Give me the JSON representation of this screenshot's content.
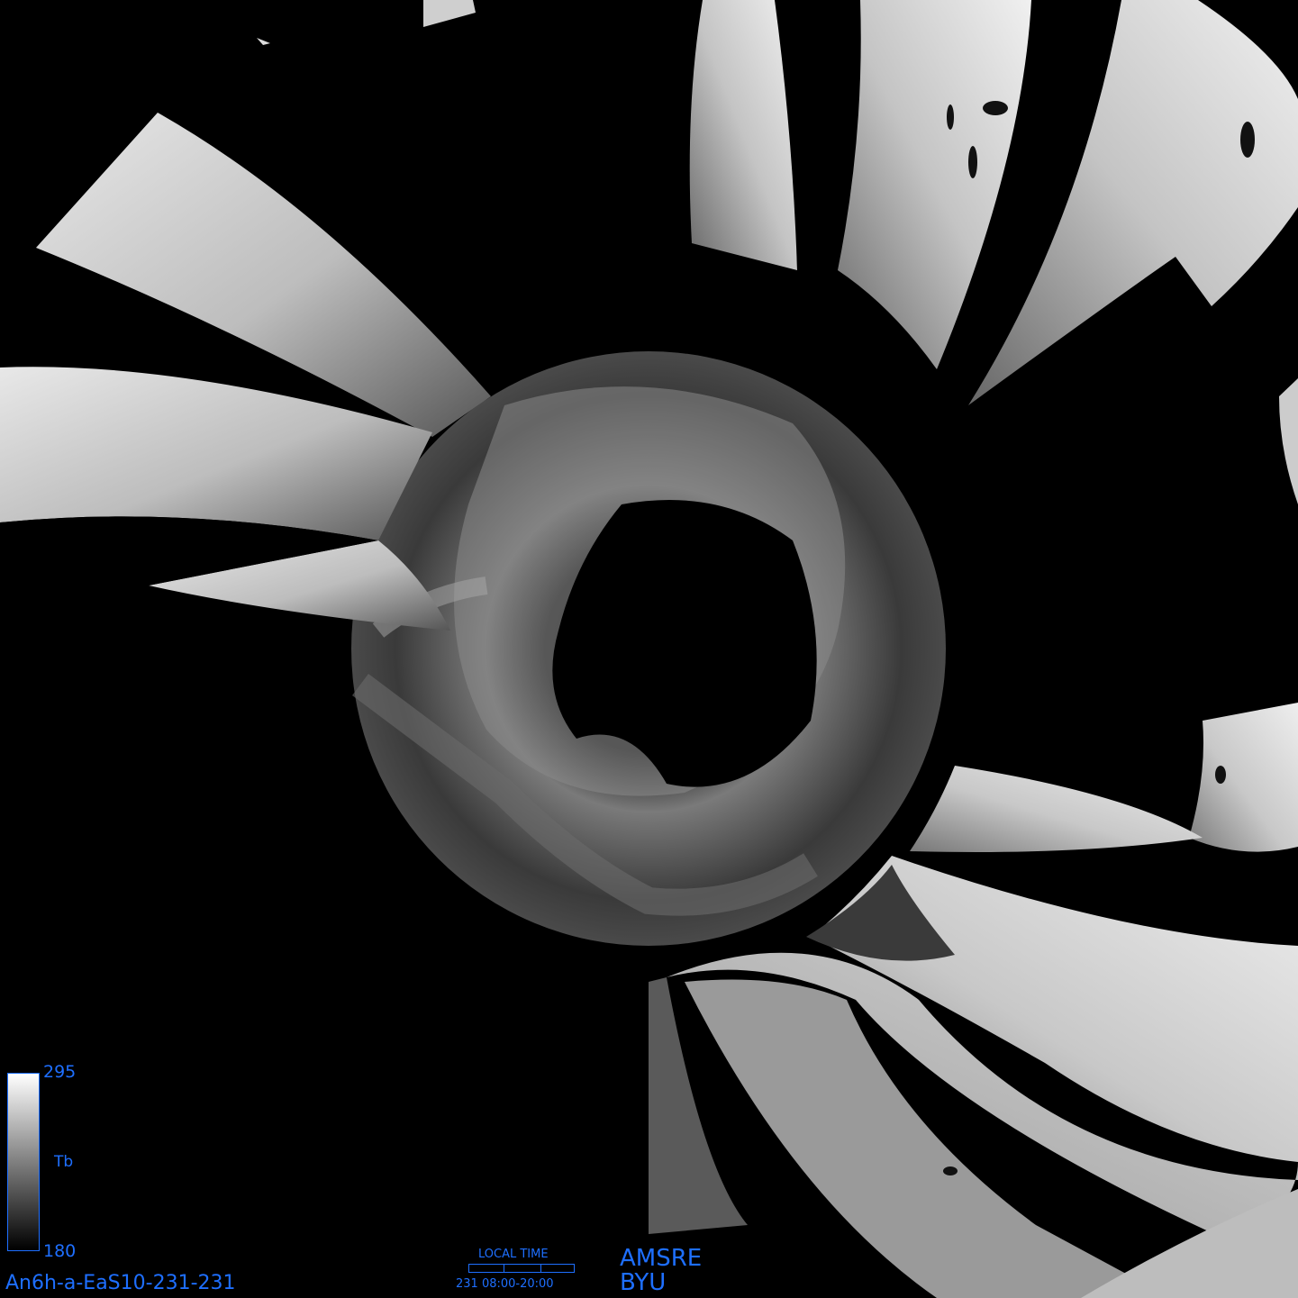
{
  "colorbar": {
    "max": "295",
    "label": "Tb",
    "min": "180"
  },
  "product_id": "An6h-a-EaS10-231-231",
  "local_time": {
    "title": "LOCAL TIME",
    "range": "231  08:00-20:00"
  },
  "sensor": "AMSRE",
  "organization": "BYU",
  "colors": {
    "label_blue": "#1e6fff",
    "background": "#000000"
  }
}
